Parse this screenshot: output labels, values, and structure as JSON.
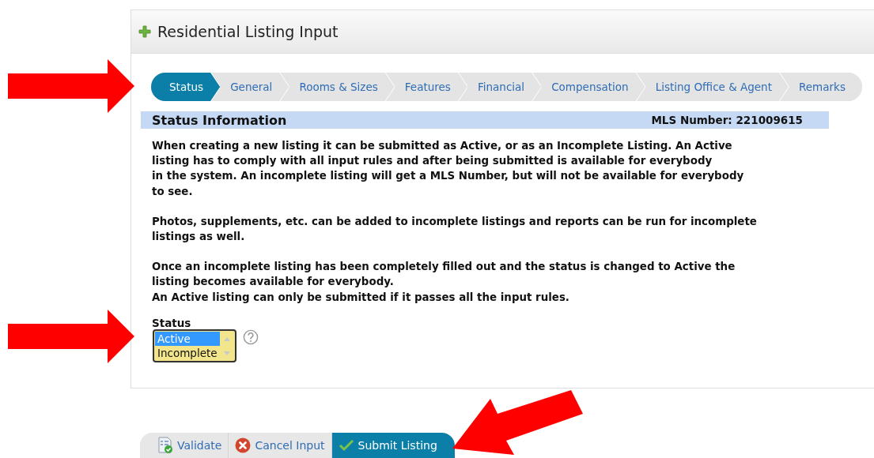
{
  "panel": {
    "title": "Residential Listing Input"
  },
  "tabs": [
    {
      "label": "Status",
      "selected": true
    },
    {
      "label": "General",
      "selected": false
    },
    {
      "label": "Rooms & Sizes",
      "selected": false
    },
    {
      "label": "Features",
      "selected": false
    },
    {
      "label": "Financial",
      "selected": false
    },
    {
      "label": "Compensation",
      "selected": false
    },
    {
      "label": "Listing Office & Agent",
      "selected": false
    },
    {
      "label": "Remarks",
      "selected": false
    }
  ],
  "section": {
    "title": "Status Information",
    "mls_number": "MLS Number: 221009615"
  },
  "paragraphs": [
    {
      "lines": [
        "When creating a new listing it can be submitted as Active, or as an Incomplete Listing. An Active",
        "listing has to comply with all input rules and after being submitted is available for everybody",
        "in the system. An incomplete listing will get a MLS Number, but will not be available for everybody",
        "to see."
      ]
    },
    {
      "lines": [
        "Photos, supplements, etc. can be added to incomplete listings and reports can be run for incomplete",
        "listings as well."
      ]
    },
    {
      "lines": [
        "Once an incomplete listing has been completely filled out and the status is changed to Active the",
        "listing becomes available for everybody.",
        "An Active listing can only be submitted if it passes all the input rules."
      ]
    }
  ],
  "status_field": {
    "label": "Status",
    "options": [
      {
        "label": "Active",
        "selected": true
      },
      {
        "label": "Incomplete",
        "selected": false
      }
    ]
  },
  "buttons": [
    {
      "label": "Validate",
      "kind": "validate",
      "primary": false
    },
    {
      "label": "Cancel Input",
      "kind": "cancel",
      "primary": false
    },
    {
      "label": "Submit Listing",
      "kind": "submit",
      "primary": true
    }
  ]
}
